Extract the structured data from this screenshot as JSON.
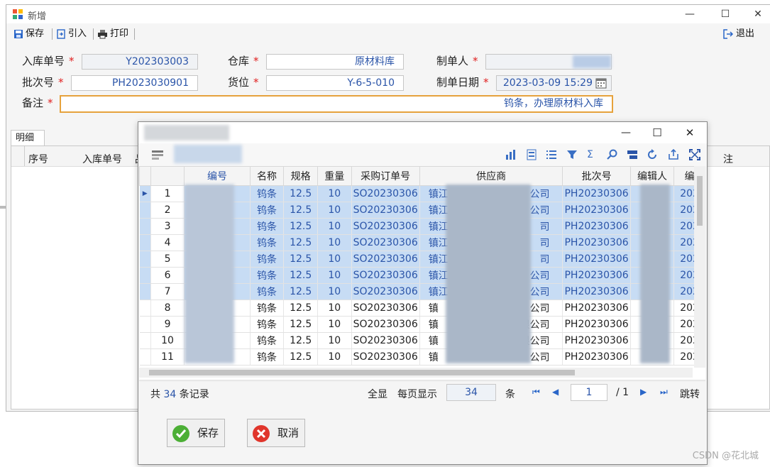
{
  "main_window": {
    "title": "新增",
    "toolbar": {
      "save": "保存",
      "import": "引入",
      "print": "打印",
      "exit": "退出"
    },
    "form": {
      "inbound_no": {
        "label": "入库单号",
        "value": "Y202303003"
      },
      "warehouse": {
        "label": "仓库",
        "value": "原材料库"
      },
      "creator": {
        "label": "制单人",
        "value": ""
      },
      "batch_no": {
        "label": "批次号",
        "value": "PH2023030901"
      },
      "location": {
        "label": "货位",
        "value": "Y-6-5-010"
      },
      "created_date": {
        "label": "制单日期",
        "value": "2023-03-09 15:29"
      },
      "remark": {
        "label": "备注",
        "value": "钨条，办理原材料入库"
      },
      "required_mark": "*"
    },
    "detail_tab": "明细",
    "detail_columns": [
      "序号",
      "入库单号",
      "品",
      "注"
    ]
  },
  "dialog": {
    "columns": [
      "编号",
      "名称",
      "规格",
      "重量",
      "采购订单号",
      "供应商",
      "批次号",
      "编辑人",
      "编"
    ],
    "rows": [
      {
        "n": "1",
        "code": "001",
        "name": "钨条",
        "spec": "12.5",
        "weight": "10",
        "po": "SO20230306",
        "supplier_a": "镇江",
        "supplier_b": "公司",
        "batch": "PH20230306",
        "date": "202",
        "hl": true
      },
      {
        "n": "2",
        "code": "002",
        "name": "钨条",
        "spec": "12.5",
        "weight": "10",
        "po": "SO20230306",
        "supplier_a": "镇江",
        "supplier_b": "公司",
        "batch": "PH20230306",
        "date": "202",
        "hl": true
      },
      {
        "n": "3",
        "code": "003",
        "name": "钨条",
        "spec": "12.5",
        "weight": "10",
        "po": "SO20230306",
        "supplier_a": "镇江",
        "supplier_b": "司",
        "batch": "PH20230306",
        "date": "202",
        "hl": true
      },
      {
        "n": "4",
        "code": "004",
        "name": "钨条",
        "spec": "12.5",
        "weight": "10",
        "po": "SO20230306",
        "supplier_a": "镇江",
        "supplier_b": "司",
        "batch": "PH20230306",
        "date": "202",
        "hl": true
      },
      {
        "n": "5",
        "code": "005",
        "name": "钨条",
        "spec": "12.5",
        "weight": "10",
        "po": "SO20230306",
        "supplier_a": "镇江",
        "supplier_b": "司",
        "batch": "PH20230306",
        "date": "202",
        "hl": true
      },
      {
        "n": "6",
        "code": "006",
        "name": "钨条",
        "spec": "12.5",
        "weight": "10",
        "po": "SO20230306",
        "supplier_a": "镇江",
        "supplier_b": "公司",
        "batch": "PH20230306",
        "date": "202",
        "hl": true
      },
      {
        "n": "7",
        "code": "007",
        "name": "钨条",
        "spec": "12.5",
        "weight": "10",
        "po": "SO20230306",
        "supplier_a": "镇江",
        "supplier_b": "公司",
        "batch": "PH20230306",
        "date": "202",
        "hl": true
      },
      {
        "n": "8",
        "code": "008",
        "name": "钨条",
        "spec": "12.5",
        "weight": "10",
        "po": "SO20230306",
        "supplier_a": "镇",
        "supplier_b": "公司",
        "batch": "PH20230306",
        "date": "202",
        "hl": false
      },
      {
        "n": "9",
        "code": "009",
        "name": "钨条",
        "spec": "12.5",
        "weight": "10",
        "po": "SO20230306",
        "supplier_a": "镇",
        "supplier_b": "限公司",
        "batch": "PH20230306",
        "date": "202",
        "hl": false
      },
      {
        "n": "10",
        "code": "010",
        "name": "钨条",
        "spec": "12.5",
        "weight": "10",
        "po": "SO20230306",
        "supplier_a": "镇",
        "supplier_b": "限公司",
        "batch": "PH20230306",
        "date": "202",
        "hl": false
      },
      {
        "n": "11",
        "code": "011",
        "name": "钨条",
        "spec": "12.5",
        "weight": "10",
        "po": "SO20230306",
        "supplier_a": "镇",
        "supplier_b": "公司",
        "batch": "PH20230306",
        "date": "202",
        "hl": false
      }
    ],
    "pager": {
      "total_prefix": "共",
      "total": "34",
      "total_suffix": "条记录",
      "show_all": "全显",
      "per_page_label": "每页显示",
      "per_page": "34",
      "unit": "条",
      "page": "1",
      "page_total": "/ 1",
      "jump": "跳转"
    },
    "buttons": {
      "save": "保存",
      "cancel": "取消"
    }
  },
  "watermark": "CSDN @花北城",
  "colors": {
    "accent": "#2a54a8",
    "highlight": "#c7dcf4",
    "required": "#e02020",
    "remark_border": "#e6a23c"
  }
}
